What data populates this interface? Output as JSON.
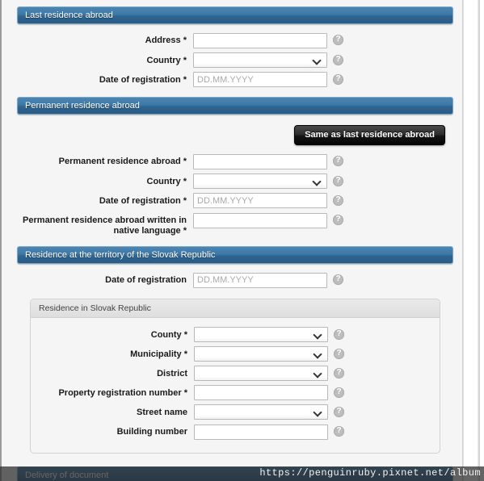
{
  "watermark": "https://penguinruby.pixnet.net/album",
  "help_icon": "help-question-icon",
  "date_placeholder": "DD.MM.YYYY",
  "sections": [
    {
      "title": "Last residence abroad",
      "fields": [
        {
          "label": "Address *",
          "type": "text",
          "placeholder": "",
          "value": "",
          "help": true
        },
        {
          "label": "Country *",
          "type": "select",
          "value": "",
          "help": true
        },
        {
          "label": "Date of registration *",
          "type": "text",
          "placeholder": "DD.MM.YYYY",
          "value": "",
          "help": true
        }
      ]
    },
    {
      "title": "Permanent residence abroad",
      "button": "Same as last residence abroad",
      "fields": [
        {
          "label": "Permanent residence abroad *",
          "type": "text",
          "placeholder": "",
          "value": "",
          "help": true
        },
        {
          "label": "Country *",
          "type": "select",
          "value": "",
          "help": true
        },
        {
          "label": "Date of registration *",
          "type": "text",
          "placeholder": "DD.MM.YYYY",
          "value": "",
          "help": true
        },
        {
          "label": "Permanent residence abroad written in\nnative language *",
          "type": "text",
          "placeholder": "",
          "value": "",
          "help": true
        }
      ]
    },
    {
      "title": "Residence at the territory of the Slovak Republic",
      "fields": [
        {
          "label": "Date of registration",
          "type": "text",
          "placeholder": "DD.MM.YYYY",
          "value": "",
          "help": true
        }
      ],
      "panel": {
        "title": "Residence in Slovak Republic",
        "fields": [
          {
            "label": "County *",
            "type": "select",
            "value": "",
            "help": true
          },
          {
            "label": "Municipality *",
            "type": "select",
            "value": "",
            "help": true
          },
          {
            "label": "District",
            "type": "select",
            "value": "",
            "help": true
          },
          {
            "label": "Property registration number *",
            "type": "text",
            "placeholder": "",
            "value": "",
            "help": true
          },
          {
            "label": "Street name",
            "type": "select",
            "value": "",
            "help": true
          },
          {
            "label": "Building number",
            "type": "text",
            "placeholder": "",
            "value": "",
            "help": true
          }
        ]
      }
    }
  ],
  "footer": {
    "title": "Delivery of document"
  }
}
